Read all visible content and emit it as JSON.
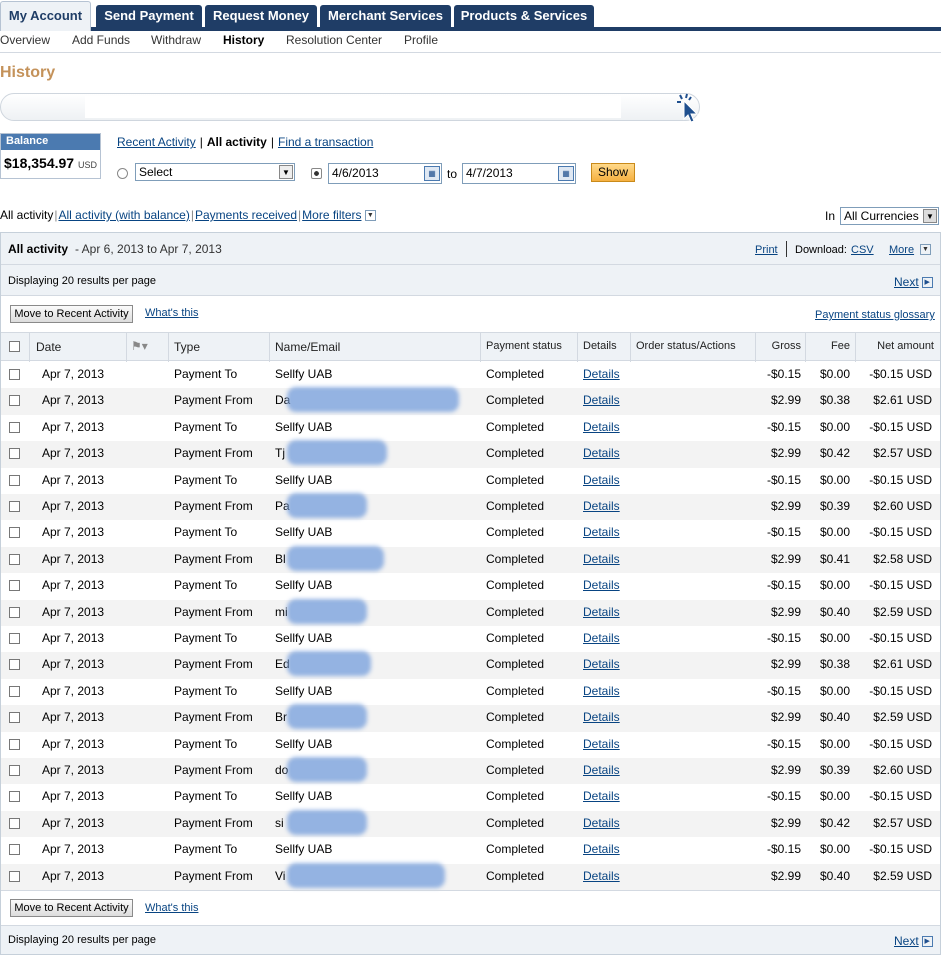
{
  "tabs": [
    "My Account",
    "Send Payment",
    "Request Money",
    "Merchant Services",
    "Products & Services"
  ],
  "subnav": [
    "Overview",
    "Add Funds",
    "Withdraw",
    "History",
    "Resolution Center",
    "Profile"
  ],
  "page_title": "History",
  "balance": {
    "label": "Balance",
    "amount": "$18,354.97",
    "currency": "USD"
  },
  "views": {
    "recent": "Recent Activity",
    "all": "All activity",
    "find": "Find a transaction"
  },
  "search": {
    "select_value": "Select",
    "date_from": "4/6/2013",
    "to_label": "to",
    "date_to": "4/7/2013",
    "show_label": "Show"
  },
  "filters": {
    "all": "All activity",
    "with_balance": "All activity (with balance)",
    "received": "Payments received",
    "more": "More filters",
    "in_label": "In",
    "currency": "All Currencies"
  },
  "panel": {
    "title": "All activity",
    "range": "- Apr 6, 2013 to Apr 7, 2013",
    "print": "Print",
    "download_label": "Download:",
    "csv": "CSV",
    "more": "More",
    "displaying": "Displaying 20 results per page",
    "next": "Next",
    "move_button": "Move to Recent Activity",
    "whats_this": "What's this",
    "glossary": "Payment status glossary"
  },
  "columns": [
    "Date",
    "Type",
    "Name/Email",
    "Payment status",
    "Details",
    "Order status/Actions",
    "Gross",
    "Fee",
    "Net amount"
  ],
  "rows": [
    {
      "date": "Apr 7, 2013",
      "type": "Payment To",
      "name": "Sellfy UAB",
      "status": "Completed",
      "details": "Details",
      "gross": "-$0.15",
      "fee": "$0.00",
      "net": "-$0.15 USD"
    },
    {
      "date": "Apr 7, 2013",
      "type": "Payment From",
      "name": "Da",
      "status": "Completed",
      "details": "Details",
      "gross": "$2.99",
      "fee": "$0.38",
      "net": "$2.61 USD"
    },
    {
      "date": "Apr 7, 2013",
      "type": "Payment To",
      "name": "Sellfy UAB",
      "status": "Completed",
      "details": "Details",
      "gross": "-$0.15",
      "fee": "$0.00",
      "net": "-$0.15 USD"
    },
    {
      "date": "Apr 7, 2013",
      "type": "Payment From",
      "name": "Tj",
      "status": "Completed",
      "details": "Details",
      "gross": "$2.99",
      "fee": "$0.42",
      "net": "$2.57 USD"
    },
    {
      "date": "Apr 7, 2013",
      "type": "Payment To",
      "name": "Sellfy UAB",
      "status": "Completed",
      "details": "Details",
      "gross": "-$0.15",
      "fee": "$0.00",
      "net": "-$0.15 USD"
    },
    {
      "date": "Apr 7, 2013",
      "type": "Payment From",
      "name": "Pa",
      "status": "Completed",
      "details": "Details",
      "gross": "$2.99",
      "fee": "$0.39",
      "net": "$2.60 USD"
    },
    {
      "date": "Apr 7, 2013",
      "type": "Payment To",
      "name": "Sellfy UAB",
      "status": "Completed",
      "details": "Details",
      "gross": "-$0.15",
      "fee": "$0.00",
      "net": "-$0.15 USD"
    },
    {
      "date": "Apr 7, 2013",
      "type": "Payment From",
      "name": "Bl",
      "status": "Completed",
      "details": "Details",
      "gross": "$2.99",
      "fee": "$0.41",
      "net": "$2.58 USD"
    },
    {
      "date": "Apr 7, 2013",
      "type": "Payment To",
      "name": "Sellfy UAB",
      "status": "Completed",
      "details": "Details",
      "gross": "-$0.15",
      "fee": "$0.00",
      "net": "-$0.15 USD"
    },
    {
      "date": "Apr 7, 2013",
      "type": "Payment From",
      "name": "mi",
      "status": "Completed",
      "details": "Details",
      "gross": "$2.99",
      "fee": "$0.40",
      "net": "$2.59 USD"
    },
    {
      "date": "Apr 7, 2013",
      "type": "Payment To",
      "name": "Sellfy UAB",
      "status": "Completed",
      "details": "Details",
      "gross": "-$0.15",
      "fee": "$0.00",
      "net": "-$0.15 USD"
    },
    {
      "date": "Apr 7, 2013",
      "type": "Payment From",
      "name": "Ed",
      "status": "Completed",
      "details": "Details",
      "gross": "$2.99",
      "fee": "$0.38",
      "net": "$2.61 USD"
    },
    {
      "date": "Apr 7, 2013",
      "type": "Payment To",
      "name": "Sellfy UAB",
      "status": "Completed",
      "details": "Details",
      "gross": "-$0.15",
      "fee": "$0.00",
      "net": "-$0.15 USD"
    },
    {
      "date": "Apr 7, 2013",
      "type": "Payment From",
      "name": "Br",
      "status": "Completed",
      "details": "Details",
      "gross": "$2.99",
      "fee": "$0.40",
      "net": "$2.59 USD"
    },
    {
      "date": "Apr 7, 2013",
      "type": "Payment To",
      "name": "Sellfy UAB",
      "status": "Completed",
      "details": "Details",
      "gross": "-$0.15",
      "fee": "$0.00",
      "net": "-$0.15 USD"
    },
    {
      "date": "Apr 7, 2013",
      "type": "Payment From",
      "name": "do",
      "status": "Completed",
      "details": "Details",
      "gross": "$2.99",
      "fee": "$0.39",
      "net": "$2.60 USD"
    },
    {
      "date": "Apr 7, 2013",
      "type": "Payment To",
      "name": "Sellfy UAB",
      "status": "Completed",
      "details": "Details",
      "gross": "-$0.15",
      "fee": "$0.00",
      "net": "-$0.15 USD"
    },
    {
      "date": "Apr 7, 2013",
      "type": "Payment From",
      "name": "si",
      "status": "Completed",
      "details": "Details",
      "gross": "$2.99",
      "fee": "$0.42",
      "net": "$2.57 USD"
    },
    {
      "date": "Apr 7, 2013",
      "type": "Payment To",
      "name": "Sellfy UAB",
      "status": "Completed",
      "details": "Details",
      "gross": "-$0.15",
      "fee": "$0.00",
      "net": "-$0.15 USD"
    },
    {
      "date": "Apr 7, 2013",
      "type": "Payment From",
      "name": "Vi",
      "status": "Completed",
      "details": "Details",
      "gross": "$2.99",
      "fee": "$0.40",
      "net": "$2.59 USD"
    }
  ]
}
